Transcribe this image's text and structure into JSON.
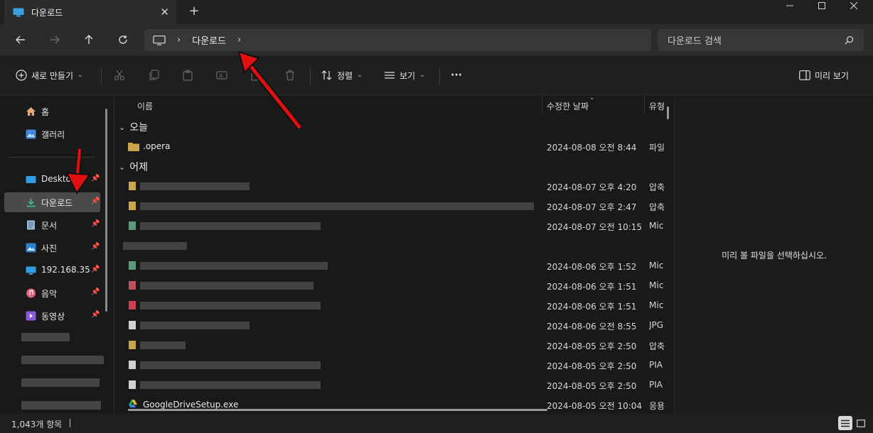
{
  "window": {
    "tab_title": "다운로드",
    "new_tab": "+",
    "close_tab": "✕"
  },
  "nav": {
    "breadcrumb": [
      "다운로드"
    ],
    "search_placeholder": "다운로드 검색"
  },
  "toolbar": {
    "new_label": "새로 만들기",
    "sort_label": "정렬",
    "view_label": "보기",
    "more_label": "···",
    "preview_label": "미리 보기"
  },
  "sidebar": {
    "items": [
      {
        "label": "홈",
        "pinned": false
      },
      {
        "label": "갤러리",
        "pinned": false
      },
      {
        "label": "Desktop",
        "pinned": true
      },
      {
        "label": "다운로드",
        "pinned": true,
        "selected": true
      },
      {
        "label": "문서",
        "pinned": true
      },
      {
        "label": "사진",
        "pinned": true
      },
      {
        "label": "192.168.35.2",
        "pinned": true
      },
      {
        "label": "음악",
        "pinned": true
      },
      {
        "label": "동영상",
        "pinned": true
      }
    ]
  },
  "columns": {
    "name": "이름",
    "modified": "수정한 날짜",
    "type": "유형"
  },
  "groups": {
    "today": "오늘",
    "yesterday": "어제"
  },
  "files": [
    {
      "name": ".opera",
      "date": "2024-08-08 오전 8:44",
      "type": "파일"
    },
    {
      "name": "",
      "date": "2024-08-07 오후 4:20",
      "type": "압축"
    },
    {
      "name": "",
      "date": "2024-08-07 오후 2:47",
      "type": "압축"
    },
    {
      "name": "",
      "date": "2024-08-07 오전 10:15",
      "type": "Mic"
    },
    {
      "name": "",
      "date": "",
      "type": ""
    },
    {
      "name": "",
      "date": "2024-08-06 오후 1:52",
      "type": "Mic"
    },
    {
      "name": "",
      "date": "2024-08-06 오후 1:51",
      "type": "Mic"
    },
    {
      "name": "",
      "date": "2024-08-06 오후 1:51",
      "type": "Mic"
    },
    {
      "name": "",
      "date": "2024-08-06 오전 8:55",
      "type": "JPG"
    },
    {
      "name": "",
      "date": "2024-08-05 오후 2:50",
      "type": "압축"
    },
    {
      "name": "",
      "date": "2024-08-05 오후 2:50",
      "type": "PIA"
    },
    {
      "name": "",
      "date": "2024-08-05 오후 2:50",
      "type": "PIA"
    },
    {
      "name": "GoogleDriveSetup.exe",
      "date": "2024-08-05 오전 10:04",
      "type": "응용"
    }
  ],
  "preview": {
    "empty_text": "미리 볼 파일을 선택하십시오."
  },
  "status": {
    "item_count": "1,043개 항목"
  },
  "colors": {
    "accent": "#4cc2ff",
    "folder": "#c9a54a",
    "annotation_arrow": "#e01010"
  }
}
